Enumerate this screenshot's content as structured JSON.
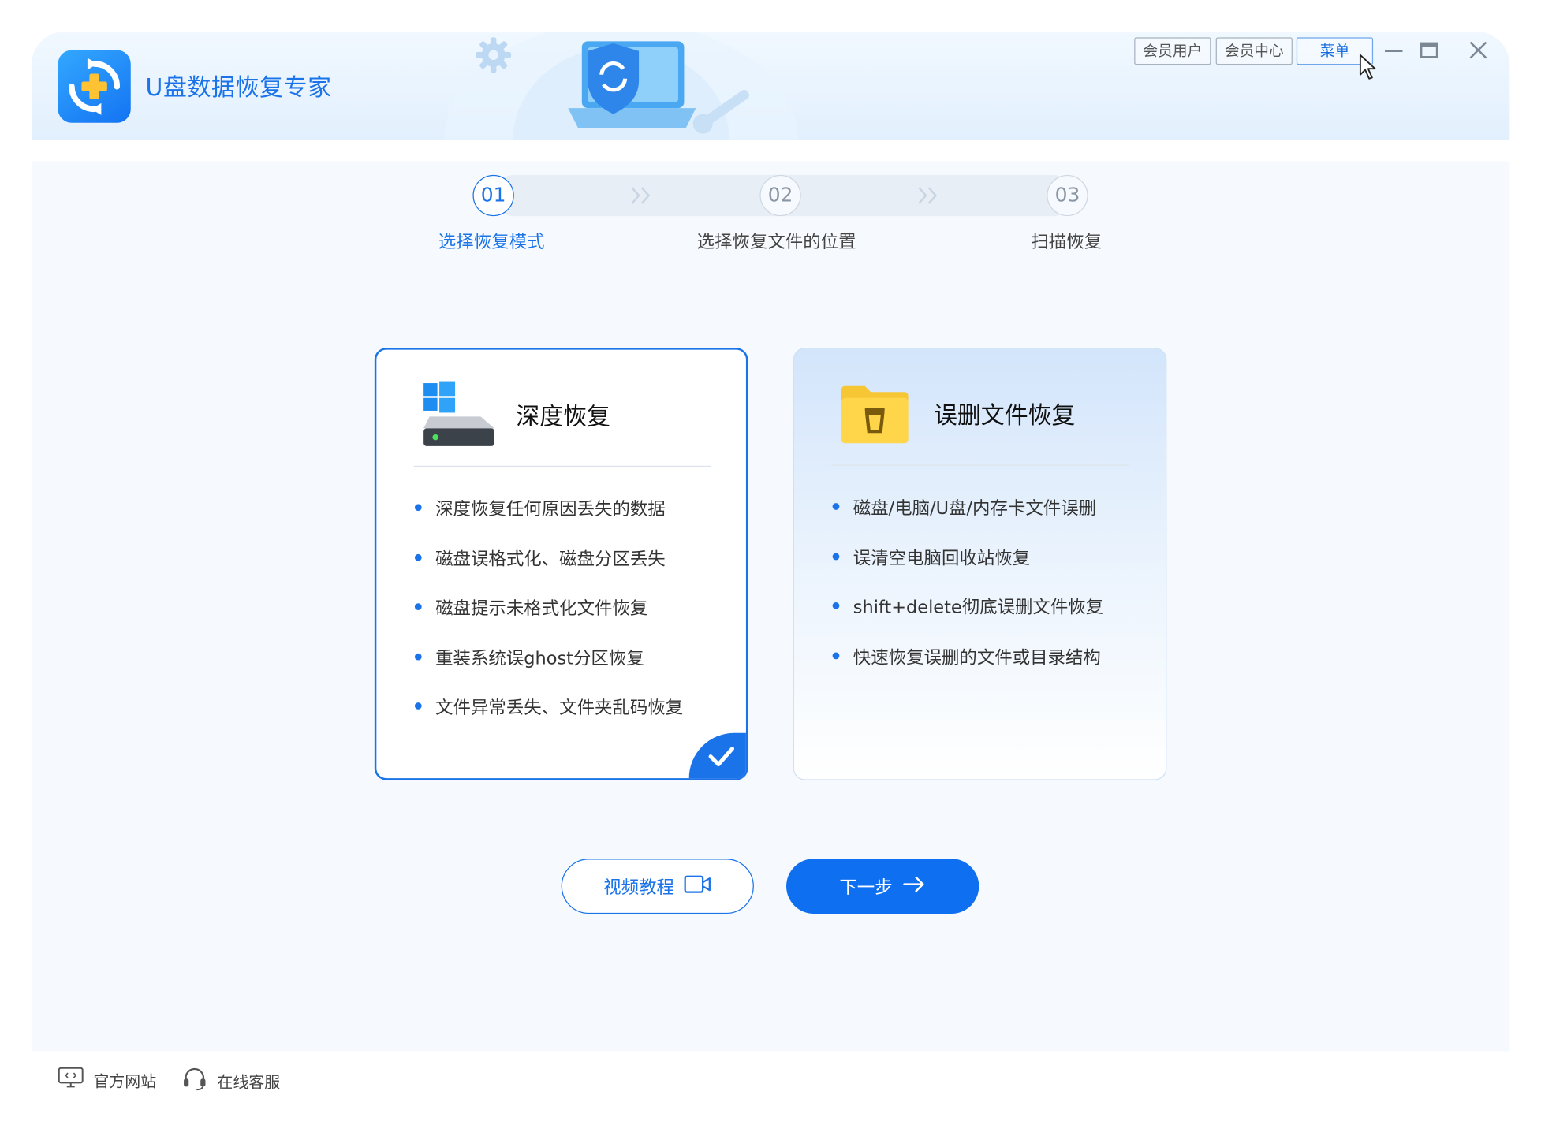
{
  "app": {
    "title": "U盘数据恢复专家"
  },
  "topbar": {
    "member_user": "会员用户",
    "member_center": "会员中心",
    "menu": "菜单"
  },
  "steps": [
    {
      "num": "01",
      "label": "选择恢复模式"
    },
    {
      "num": "02",
      "label": "选择恢复文件的位置"
    },
    {
      "num": "03",
      "label": "扫描恢复"
    }
  ],
  "cards": {
    "deep": {
      "title": "深度恢复",
      "items": [
        "深度恢复任何原因丢失的数据",
        "磁盘误格式化、磁盘分区丢失",
        "磁盘提示未格式化文件恢复",
        "重装系统误ghost分区恢复",
        "文件异常丢失、文件夹乱码恢复"
      ]
    },
    "deleted": {
      "title": "误删文件恢复",
      "items": [
        "磁盘/电脑/U盘/内存卡文件误删",
        "误清空电脑回收站恢复",
        "shift+delete彻底误删文件恢复",
        "快速恢复误删的文件或目录结构"
      ]
    }
  },
  "buttons": {
    "video": "视频教程",
    "next": "下一步"
  },
  "footer": {
    "website": "官方网站",
    "support": "在线客服"
  },
  "colors": {
    "accent": "#1a73e8",
    "primary_button": "#0e6ff0",
    "folder": "#f7c634"
  }
}
